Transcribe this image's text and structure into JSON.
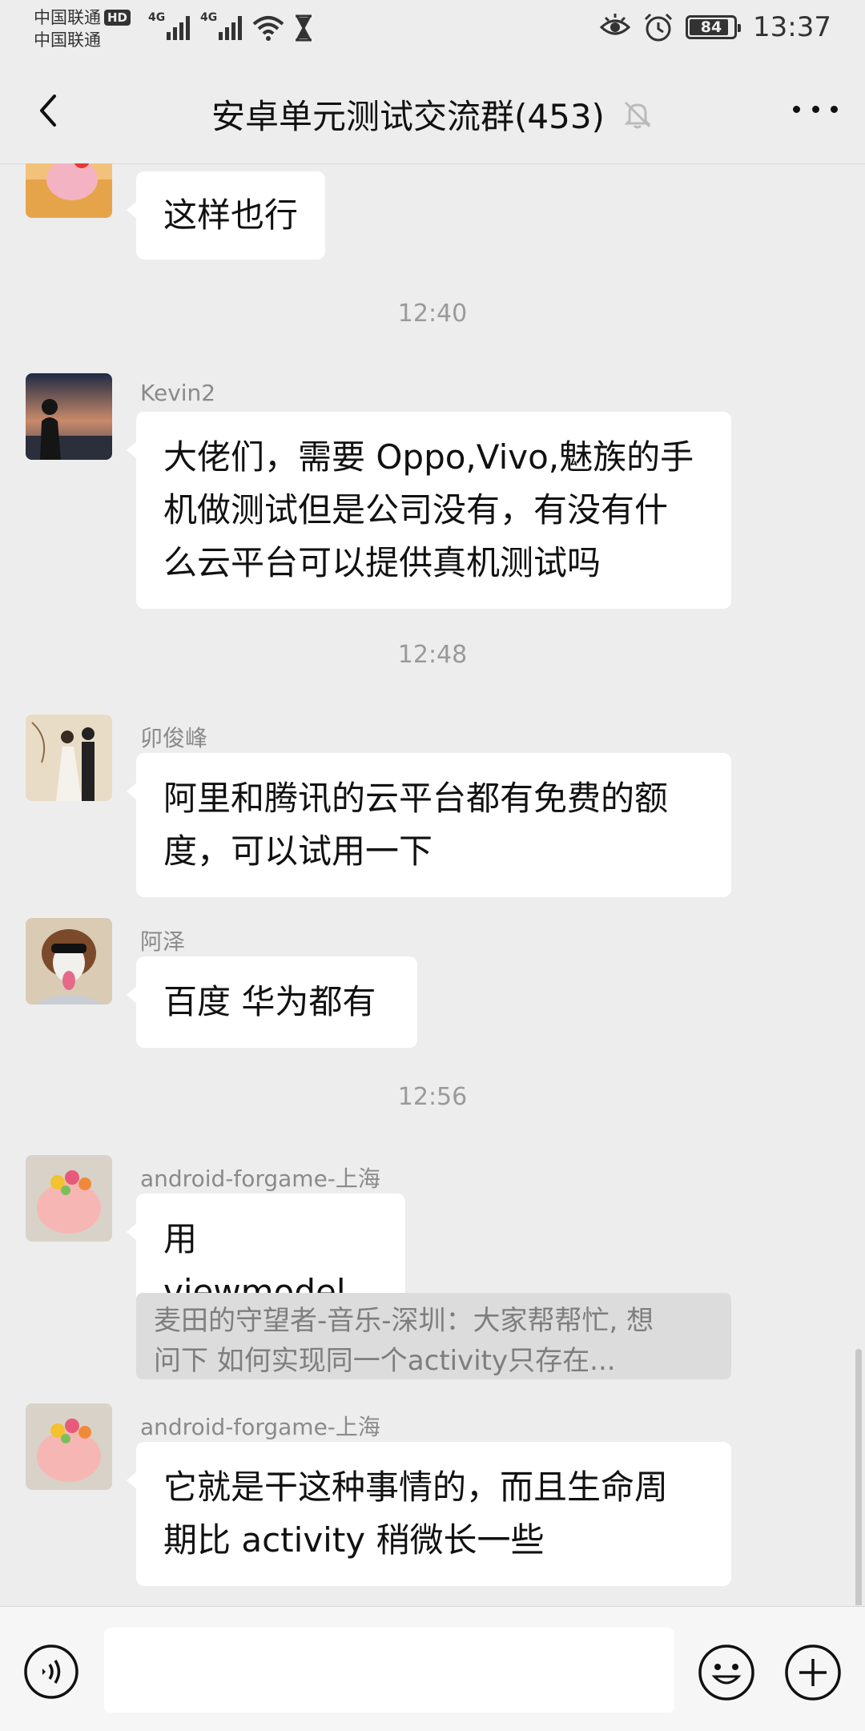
{
  "status_bar": {
    "carrier1": "中国联通",
    "carrier2": "中国联通",
    "hd": "HD",
    "network1": "4G",
    "network2": "4G",
    "battery_level": "84",
    "time": "13:37"
  },
  "header": {
    "title": "安卓单元测试交流群(453)"
  },
  "chat": {
    "top_message": {
      "text": "这样也行"
    },
    "timestamps": [
      "12:40",
      "12:48",
      "12:56"
    ],
    "messages": [
      {
        "sender": "Kevin2",
        "lines": [
          "大佬们，需要 Oppo,Vivo,魅族的手",
          "机做测试但是公司没有，有没有什",
          "么云平台可以提供真机测试吗"
        ]
      },
      {
        "sender": "卯俊峰",
        "lines": [
          "阿里和腾讯的云平台都有免费的额",
          "度，可以试用一下"
        ]
      },
      {
        "sender": "阿泽",
        "lines": [
          "百度 华为都有"
        ]
      },
      {
        "sender": "android-forgame-上海",
        "lines": [
          "用 viewmodel"
        ],
        "quote_line1": "麦田的守望者-音乐-深圳：大家帮帮忙, 想",
        "quote_line2": "问下   如何实现同一个activity只存在..."
      },
      {
        "sender": "android-forgame-上海",
        "lines": [
          "它就是干这种事情的，而且生命周",
          "期比 activity 稍微长一些"
        ]
      }
    ]
  },
  "icons": {
    "back": "back-arrow-icon",
    "mute": "bell-off-icon",
    "more": "more-dots-icon",
    "voice": "voice-icon",
    "emoji": "emoji-icon",
    "plus": "plus-icon"
  }
}
